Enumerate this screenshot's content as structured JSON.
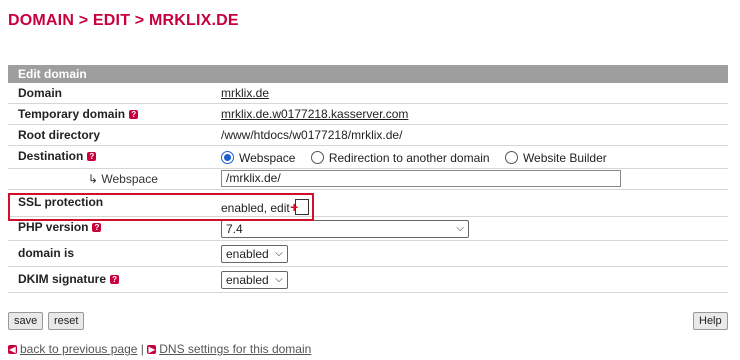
{
  "page_title": "DOMAIN > EDIT > MRKLIX.DE",
  "panel": {
    "heading": "Edit domain",
    "domain": {
      "label": "Domain",
      "value": "mrklix.de"
    },
    "temp_domain": {
      "label": "Temporary domain",
      "value": "mrklix.de.w0177218.kasserver.com"
    },
    "root_dir": {
      "label": "Root directory",
      "value": "/www/htdocs/w0177218/mrklix.de/"
    },
    "destination": {
      "label": "Destination",
      "options": [
        "Webspace",
        "Redirection to another domain",
        "Website Builder"
      ],
      "selected": "Webspace"
    },
    "webspace": {
      "label": "↳ Webspace",
      "value": "/mrklix.de/"
    },
    "ssl": {
      "label": "SSL protection",
      "value": "enabled, edit"
    },
    "php": {
      "label": "PHP version",
      "selected": "7.4"
    },
    "domain_is": {
      "label": "domain is",
      "selected": "enabled"
    },
    "dkim": {
      "label": "DKIM signature",
      "selected": "enabled"
    }
  },
  "buttons": {
    "save": "save",
    "reset": "reset",
    "help": "Help"
  },
  "footer": {
    "back": "back to previous page",
    "separator": "|",
    "dns": "DNS settings for this domain"
  },
  "colors": {
    "accent": "#c8003c",
    "header_bg": "#9e9e9e",
    "highlight": "#d0102a"
  }
}
